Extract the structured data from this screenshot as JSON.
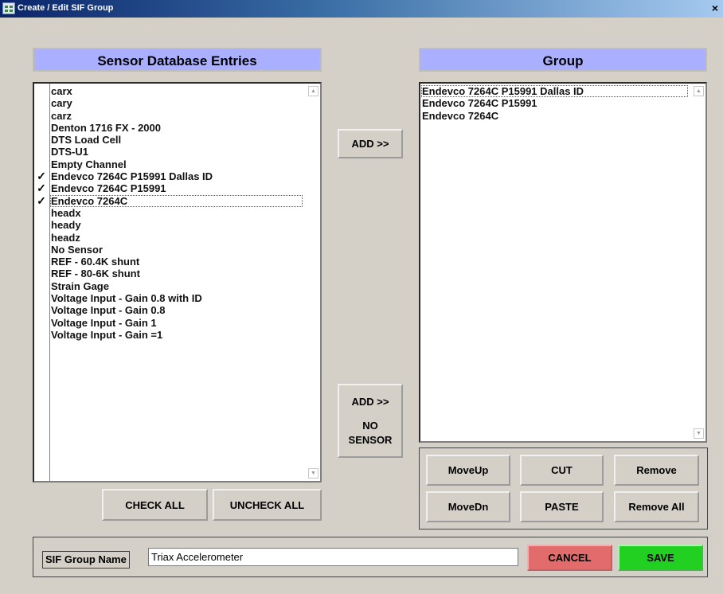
{
  "window": {
    "title": "Create / Edit SIF Group",
    "close_glyph": "×"
  },
  "sensor_panel": {
    "header": "Sensor Database Entries",
    "items": [
      {
        "label": "carx",
        "checked": false
      },
      {
        "label": "cary",
        "checked": false
      },
      {
        "label": "carz",
        "checked": false
      },
      {
        "label": "Denton 1716 FX - 2000",
        "checked": false
      },
      {
        "label": "DTS Load Cell",
        "checked": false
      },
      {
        "label": "DTS-U1",
        "checked": false
      },
      {
        "label": "Empty Channel",
        "checked": false
      },
      {
        "label": "Endevco 7264C P15991 Dallas ID",
        "checked": true
      },
      {
        "label": "Endevco 7264C P15991",
        "checked": true
      },
      {
        "label": "Endevco 7264C",
        "checked": true,
        "focused": true
      },
      {
        "label": "headx",
        "checked": false
      },
      {
        "label": "heady",
        "checked": false
      },
      {
        "label": "headz",
        "checked": false
      },
      {
        "label": "No Sensor",
        "checked": false
      },
      {
        "label": "REF - 60.4K shunt",
        "checked": false
      },
      {
        "label": "REF - 80-6K shunt",
        "checked": false
      },
      {
        "label": "Strain Gage",
        "checked": false
      },
      {
        "label": "Voltage Input - Gain  0.8 with ID",
        "checked": false
      },
      {
        "label": "Voltage Input - Gain  0.8",
        "checked": false
      },
      {
        "label": "Voltage Input - Gain 1",
        "checked": false
      },
      {
        "label": "Voltage Input - Gain =1",
        "checked": false
      }
    ],
    "check_all_label": "CHECK ALL",
    "uncheck_all_label": "UNCHECK ALL",
    "checkmark_glyph": "✓"
  },
  "transfer": {
    "add_label": "ADD >>",
    "add_no_sensor_line1": "ADD >>",
    "add_no_sensor_line2": "NO",
    "add_no_sensor_line3": "SENSOR"
  },
  "group_panel": {
    "header": "Group",
    "items": [
      {
        "label": "Endevco 7264C P15991 Dallas ID",
        "focused": true
      },
      {
        "label": "Endevco 7264C P15991",
        "focused": false
      },
      {
        "label": "Endevco 7264C",
        "focused": false
      }
    ],
    "buttons": {
      "move_up": "MoveUp",
      "cut": "CUT",
      "remove": "Remove",
      "move_down": "MoveDn",
      "paste": "PASTE",
      "remove_all": "Remove All"
    }
  },
  "footer": {
    "name_label": "SIF Group Name",
    "name_value": "Triax Accelerometer",
    "cancel_label": "CANCEL",
    "save_label": "SAVE"
  },
  "colors": {
    "header_bg": "#aab0ff",
    "cancel_bg": "#e26b6b",
    "save_bg": "#22d022",
    "dialog_bg": "#d4d0c8"
  }
}
